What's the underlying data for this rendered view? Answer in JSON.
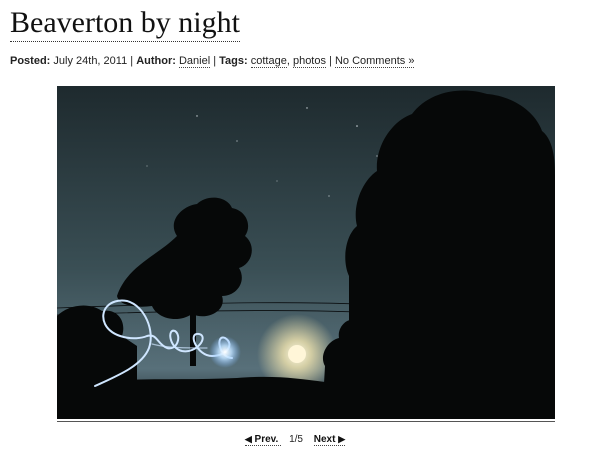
{
  "post": {
    "title": "Beaverton by night",
    "meta": {
      "posted_label": "Posted:",
      "date": "July 24th, 2011",
      "sep": "|",
      "author_label": "Author:",
      "author": "Daniel",
      "tags_label": "Tags:",
      "tags": [
        "cottage",
        "photos"
      ],
      "tag_sep": ",",
      "comments": "No Comments »"
    },
    "photo": {
      "colors": {
        "sky_top": "#1e2a2e",
        "sky_mid": "#3a4f55",
        "sky_horizon": "#58707a",
        "trees": "#060808",
        "light_trail": "#cfe6ff",
        "glow": "#ffffff",
        "moon": "#fff6d8"
      }
    },
    "pager": {
      "prev": "Prev.",
      "count": "1/5",
      "next": "Next",
      "prev_icon": "triangle-left-icon",
      "next_icon": "triangle-right-icon"
    }
  }
}
